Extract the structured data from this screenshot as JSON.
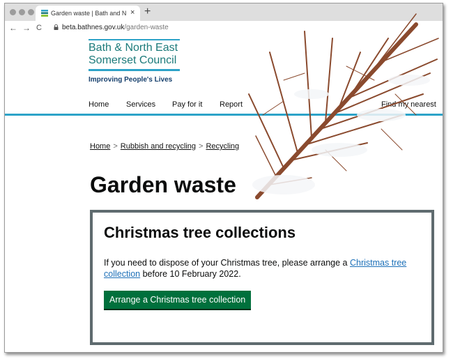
{
  "browser": {
    "tab_title": "Garden waste | Bath and North East Somerset Council",
    "tab_close": "×",
    "new_tab": "+",
    "back": "←",
    "forward": "→",
    "reload": "C",
    "url_host": "beta.bathnes.gov.uk",
    "url_path": "/garden-waste"
  },
  "header": {
    "logo_line1": "Bath & North East",
    "logo_line2": "Somerset Council",
    "tagline": "Improving People's Lives",
    "brand_color": "#1b7a7a",
    "accent_color": "#2da3c8"
  },
  "nav": {
    "items": [
      "Home",
      "Services",
      "Pay for it",
      "Report",
      "",
      "Find my nearest"
    ]
  },
  "breadcrumb": {
    "items": [
      "Home",
      "Rubbish and recycling",
      "Recycling"
    ],
    "separator": ">"
  },
  "page": {
    "title": "Garden waste"
  },
  "callout": {
    "heading": "Christmas tree collections",
    "text_before": "If you need to dispose of your Christmas tree, please arrange a ",
    "link_text": "Christmas tree collection",
    "text_after": " before 10 February 2022.",
    "button_label": "Arrange a Christmas tree collection",
    "button_color": "#00703c"
  }
}
